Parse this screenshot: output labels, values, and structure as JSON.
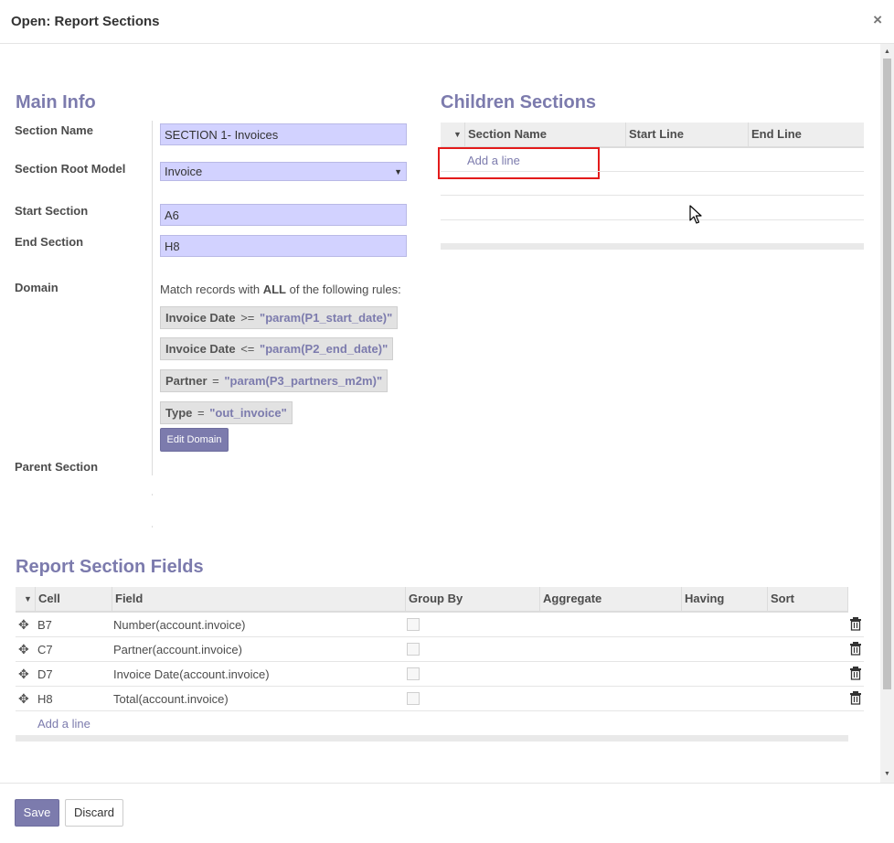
{
  "dialog": {
    "title": "Open: Report Sections",
    "close_glyph": "×"
  },
  "main_info": {
    "heading": "Main Info",
    "section_name": {
      "label": "Section Name",
      "value": "SECTION 1- Invoices"
    },
    "root_model": {
      "label": "Section Root Model",
      "value": "Invoice"
    },
    "start_section": {
      "label": "Start Section",
      "value": "A6"
    },
    "end_section": {
      "label": "End Section",
      "value": "H8"
    },
    "domain": {
      "label": "Domain",
      "match_prefix": "Match records with",
      "match_all": "ALL",
      "match_suffix": "of the following rules:",
      "rules": [
        {
          "field": "Invoice Date",
          "op": ">=",
          "value": "\"param(P1_start_date)\""
        },
        {
          "field": "Invoice Date",
          "op": "<=",
          "value": "\"param(P2_end_date)\""
        },
        {
          "field": "Partner",
          "op": "=",
          "value": "\"param(P3_partners_m2m)\""
        },
        {
          "field": "Type",
          "op": "=",
          "value": "\"out_invoice\""
        }
      ],
      "edit_button": "Edit Domain"
    },
    "parent_section": {
      "label": "Parent Section"
    }
  },
  "children": {
    "heading": "Children Sections",
    "columns": [
      "Section Name",
      "Start Line",
      "End Line"
    ],
    "add_line": "Add a line"
  },
  "fields": {
    "heading": "Report Section Fields",
    "columns": [
      "Cell",
      "Field",
      "Group By",
      "Aggregate",
      "Having",
      "Sort"
    ],
    "rows": [
      {
        "cell": "B7",
        "field": "Number(account.invoice)"
      },
      {
        "cell": "C7",
        "field": "Partner(account.invoice)"
      },
      {
        "cell": "D7",
        "field": "Invoice Date(account.invoice)"
      },
      {
        "cell": "H8",
        "field": "Total(account.invoice)"
      }
    ],
    "add_line": "Add a line"
  },
  "footer": {
    "save": "Save",
    "discard": "Discard"
  },
  "colors": {
    "accent": "#7c7bad",
    "input_bg": "#d2d2ff",
    "highlight": "#e31b1b"
  }
}
